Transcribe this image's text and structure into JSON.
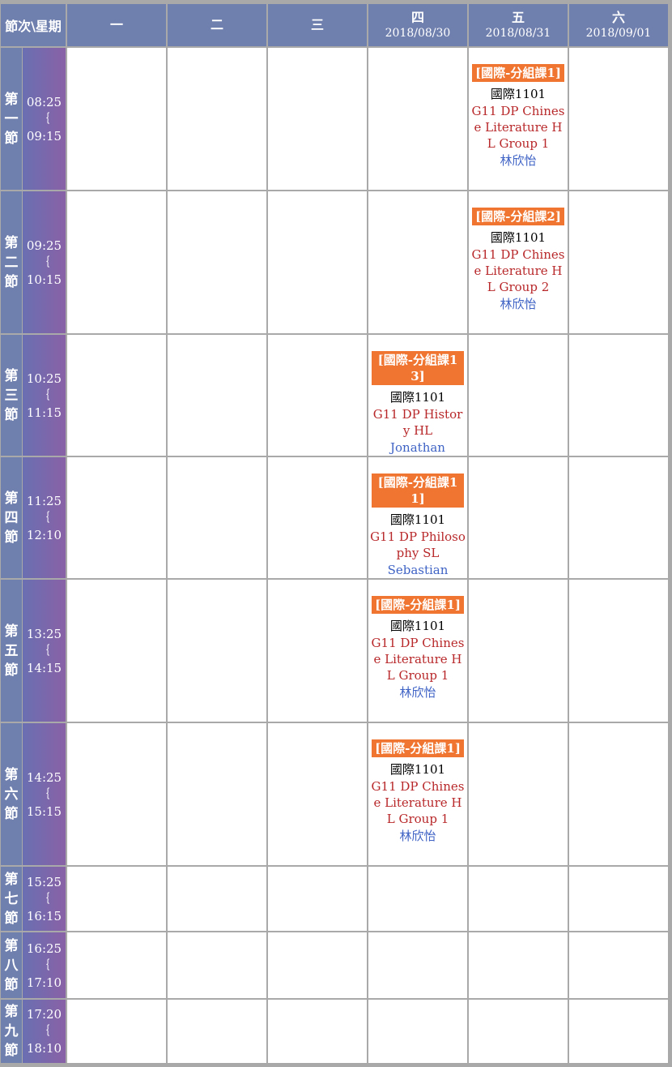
{
  "corner_label": "節次\\星期",
  "days": [
    {
      "label": "一",
      "date": ""
    },
    {
      "label": "二",
      "date": ""
    },
    {
      "label": "三",
      "date": ""
    },
    {
      "label": "四",
      "date": "2018/08/30"
    },
    {
      "label": "五",
      "date": "2018/08/31"
    },
    {
      "label": "六",
      "date": "2018/09/01"
    }
  ],
  "periods": [
    {
      "name": "第一節",
      "start": "08:25",
      "sep": "｛",
      "end": "09:15"
    },
    {
      "name": "第二節",
      "start": "09:25",
      "sep": "｛",
      "end": "10:15"
    },
    {
      "name": "第三節",
      "start": "10:25",
      "sep": "｛",
      "end": "11:15"
    },
    {
      "name": "第四節",
      "start": "11:25",
      "sep": "｛",
      "end": "12:10"
    },
    {
      "name": "第五節",
      "start": "13:25",
      "sep": "｛",
      "end": "14:15"
    },
    {
      "name": "第六節",
      "start": "14:25",
      "sep": "｛",
      "end": "15:15"
    },
    {
      "name": "第七節",
      "start": "15:25",
      "sep": "｛",
      "end": "16:15"
    },
    {
      "name": "第八節",
      "start": "16:25",
      "sep": "｛",
      "end": "17:10"
    },
    {
      "name": "第九節",
      "start": "17:20",
      "sep": "｛",
      "end": "18:10"
    }
  ],
  "courses": [
    {
      "period": 0,
      "day": 4,
      "tag": "[國際-分組課1]",
      "room": "國際1101",
      "subject": "G11 DP Chinese Literature HL Group 1",
      "teacher": "林欣怡"
    },
    {
      "period": 1,
      "day": 4,
      "tag": "[國際-分組課2]",
      "room": "國際1101",
      "subject": "G11 DP Chinese Literature HL Group 2",
      "teacher": "林欣怡"
    },
    {
      "period": 2,
      "day": 3,
      "tag": "[國際-分組課13]",
      "room": "國際1101",
      "subject": "G11 DP History HL",
      "teacher": "Jonathan"
    },
    {
      "period": 3,
      "day": 3,
      "tag": "[國際-分組課11]",
      "room": "國際1101",
      "subject": "G11 DP Philosophy SL",
      "teacher": "Sebastian"
    },
    {
      "period": 4,
      "day": 3,
      "tag": "[國際-分組課1]",
      "room": "國際1101",
      "subject": "G11 DP Chinese Literature HL Group 1",
      "teacher": "林欣怡"
    },
    {
      "period": 5,
      "day": 3,
      "tag": "[國際-分組課1]",
      "room": "國際1101",
      "subject": "G11 DP Chinese Literature HL Group 1",
      "teacher": "林欣怡"
    }
  ],
  "colors": {
    "header_bg": "#6f7fae",
    "time_gradient_start": "#6a6fb2",
    "time_gradient_end": "#8961a6",
    "tag_bg": "#ef7530",
    "subject_text": "#b8282a",
    "teacher_text": "#3f63c5",
    "grid_line": "#a9a9a9"
  }
}
